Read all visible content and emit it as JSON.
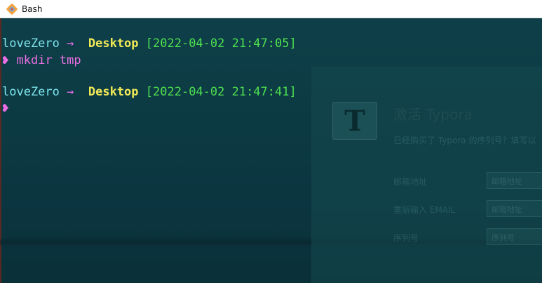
{
  "window": {
    "title": "Bash",
    "icon": "git-bash-icon"
  },
  "terminal": {
    "lines": [
      {
        "type": "header",
        "user": "loveZero",
        "arrow": "→",
        "dir": "Desktop",
        "timestamp": "[2022-04-02 21:47:05]"
      },
      {
        "type": "command",
        "prompt": "❥",
        "command": "mkdir tmp"
      },
      {
        "type": "header",
        "user": "loveZero",
        "arrow": "→",
        "dir": "Desktop",
        "timestamp": "[2022-04-02 21:47:41]"
      },
      {
        "type": "command",
        "prompt": "❥",
        "command": ""
      }
    ]
  },
  "background_dialog": {
    "logo": "T",
    "title": "激活 Typora",
    "subtitle": "已经购买了 Typora 的序列号？填写以",
    "fields": [
      {
        "label": "邮箱地址",
        "placeholder": "邮箱地址"
      },
      {
        "label": "重新输入 EMAIL",
        "placeholder": "邮箱地址"
      },
      {
        "label": "序列号",
        "placeholder": "序列号"
      }
    ]
  },
  "colors": {
    "user": "#7ee4ec",
    "arrow": "#e86de8",
    "dir": "#f2ea56",
    "timestamp": "#4fe04f",
    "command": "#ec6fe4",
    "background": "#0d3c45"
  }
}
